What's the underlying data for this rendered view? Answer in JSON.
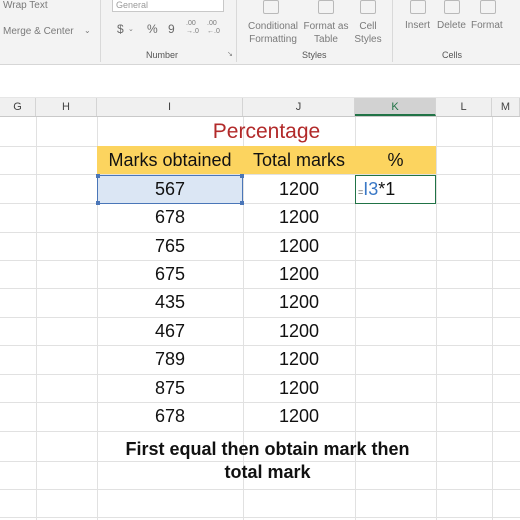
{
  "ribbon": {
    "wrap_text": "Wrap Text",
    "merge_center": "Merge & Center",
    "number_format": "General",
    "currency": "$",
    "percent": "%",
    "comma": "9",
    "dec_increase": ".00 →.0",
    "dec_decrease": ".00 ←.0",
    "number_group": "Number",
    "conditional_formatting": "Conditional Formatting",
    "format_as_table": "Format as Table",
    "cell_styles": "Cell Styles",
    "styles_group": "Styles",
    "insert": "Insert",
    "delete": "Delete",
    "format": "Format",
    "cells_group": "Cells"
  },
  "columns": [
    "G",
    "H",
    "I",
    "J",
    "K",
    "L",
    "M"
  ],
  "active_column": "K",
  "sheet": {
    "title": "Percentage",
    "headers": [
      "Marks obtained",
      "Total marks",
      "%"
    ],
    "rows": [
      {
        "obtained": "567",
        "total": "1200"
      },
      {
        "obtained": "678",
        "total": "1200"
      },
      {
        "obtained": "765",
        "total": "1200"
      },
      {
        "obtained": "675",
        "total": "1200"
      },
      {
        "obtained": "435",
        "total": "1200"
      },
      {
        "obtained": "467",
        "total": "1200"
      },
      {
        "obtained": "789",
        "total": "1200"
      },
      {
        "obtained": "875",
        "total": "1200"
      },
      {
        "obtained": "678",
        "total": "1200"
      }
    ],
    "formula_eq": "=",
    "formula_ref": "I3",
    "formula_rest": "*1"
  },
  "caption": {
    "line1": "First equal then obtain mark then",
    "line2": "total mark"
  },
  "colors": {
    "title": "#b22a2a",
    "header_band": "#fcd45f",
    "selection": "#dbe6f4",
    "active_border": "#217346"
  }
}
